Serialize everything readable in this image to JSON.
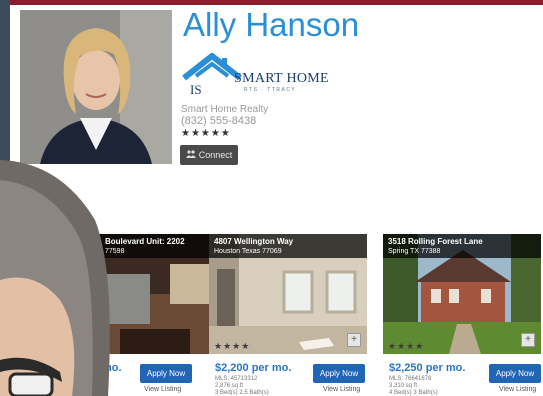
{
  "agent": {
    "name": "Ally Hanson",
    "company": "Smart Home Realty",
    "phone": "(832) 555-8438",
    "rating_stars": 5,
    "stars_text": "★★★★★",
    "connect_label": "Connect"
  },
  "logo": {
    "name": "SMART HOME",
    "tagline": "RTS · TTRACY"
  },
  "listings": [
    {
      "address": "Boulevard Unit: 2202",
      "city": "77598",
      "price": "mo.",
      "apply_label": "Apply Now",
      "view_label": "View Listing"
    },
    {
      "address": "4807 Wellington Way",
      "city": "Houston Texas 77069",
      "price": "$2,200 per mo.",
      "mls": "MLS: 45713312",
      "sqft": "2,876 sq ft",
      "beds": "3 Bed(s) 2.5 Bath(s)",
      "stars_text": "★★★★",
      "apply_label": "Apply Now",
      "view_label": "View Listing"
    },
    {
      "address": "3518 Rolling Forest Lane",
      "city": "Spring TX 77388",
      "price": "$2,250 per mo.",
      "mls": "MLS: 76641678",
      "sqft": "3,310 sq ft",
      "beds": "4 Bed(s) 3 Bath(s)",
      "stars_text": "★★★★",
      "apply_label": "Apply Now",
      "view_label": "View Listing"
    }
  ],
  "colors": {
    "accent": "#2a8fd6",
    "button": "#2165b5",
    "topbar": "#8a1c2b",
    "tab": "#f4a531"
  }
}
